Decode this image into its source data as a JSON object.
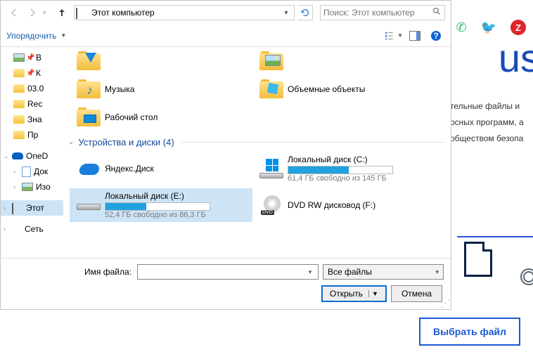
{
  "background": {
    "big_text": "us",
    "para_line1": "тельные файлы и",
    "para_line2": "осных программ, а",
    "para_line3": "обществом безопа",
    "select_button": "Выбрать файл",
    "twitter_color": "#1da1f2",
    "z_color": "#e0262a",
    "phone_color": "#2bb673"
  },
  "dialog": {
    "address": "Этот компьютер",
    "search_placeholder": "Поиск: Этот компьютер",
    "organize": "Упорядочить",
    "sidebar": {
      "quick": [
        {
          "label": "В"
        },
        {
          "label": "К"
        },
        {
          "label": "03.0"
        },
        {
          "label": "Rec"
        },
        {
          "label": "Зна"
        },
        {
          "label": "Пр"
        }
      ],
      "onedrive": "OneD",
      "onedrive_children": [
        {
          "label": "Док"
        },
        {
          "label": "Изо"
        }
      ],
      "this_pc": "Этот",
      "network": "Сеть"
    },
    "folders": {
      "downloads": "Загрузки",
      "music": "Музыка",
      "pictures": "Изображения",
      "objects3d": "Объемные объекты",
      "desktop": "Рабочий стол"
    },
    "group_devices": "Устройства и диски (4)",
    "drives": {
      "yadisk": {
        "name": "Яндекс.Диск"
      },
      "c": {
        "name": "Локальный диск (C:)",
        "sub": "61,4 ГБ свободно из 145 ГБ",
        "pct": 58
      },
      "e": {
        "name": "Локальный диск (E:)",
        "sub": "52,4 ГБ свободно из 86,3 ГБ",
        "pct": 39
      },
      "dvd": {
        "name": "DVD RW дисковод (F:)"
      }
    },
    "footer": {
      "filename_label": "Имя файла:",
      "filename_value": "",
      "filter": "Все файлы",
      "open": "Открыть",
      "cancel": "Отмена"
    }
  }
}
